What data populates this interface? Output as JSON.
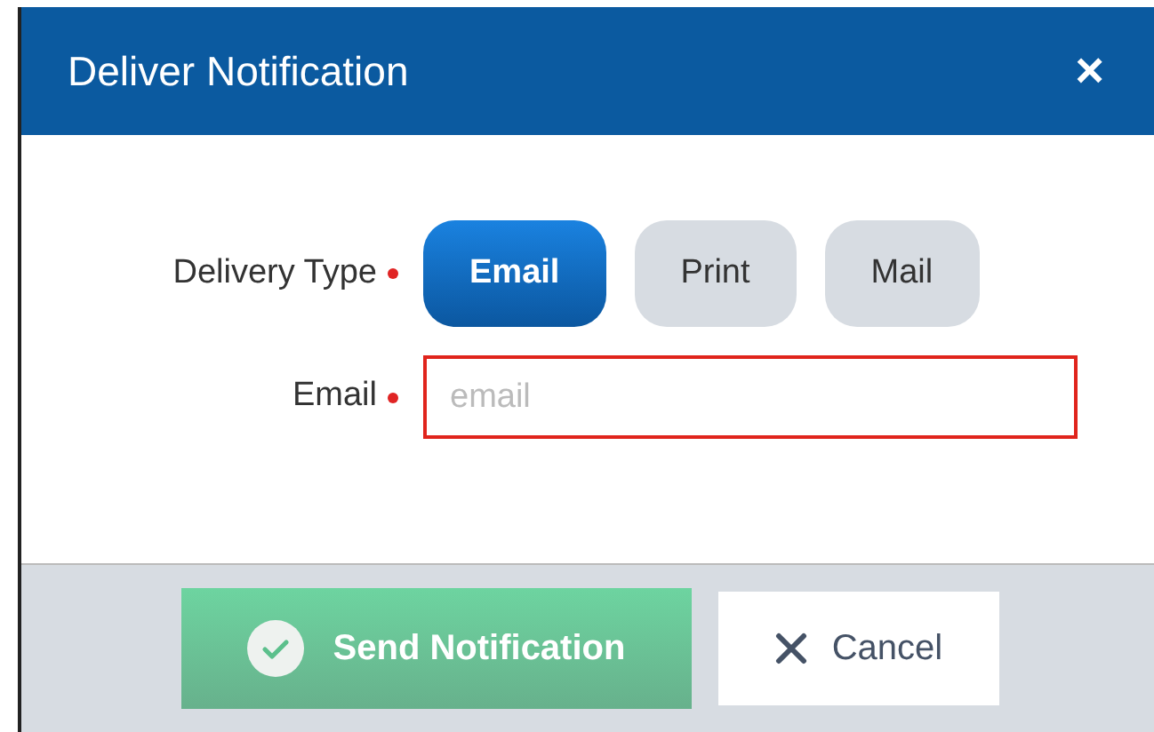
{
  "dialog": {
    "title": "Deliver Notification",
    "close": "×"
  },
  "delivery_type": {
    "label": "Delivery Type",
    "required": true,
    "options": [
      {
        "label": "Email",
        "selected": true
      },
      {
        "label": "Print",
        "selected": false
      },
      {
        "label": "Mail",
        "selected": false
      }
    ]
  },
  "email": {
    "label": "Email",
    "required": true,
    "placeholder": "email",
    "invalid": true
  },
  "buttons": [
    {
      "kind": "send",
      "label": "Send Notification",
      "disabled": true
    },
    {
      "kind": "cancel",
      "label": "Cancel",
      "disabled": false
    }
  ]
}
